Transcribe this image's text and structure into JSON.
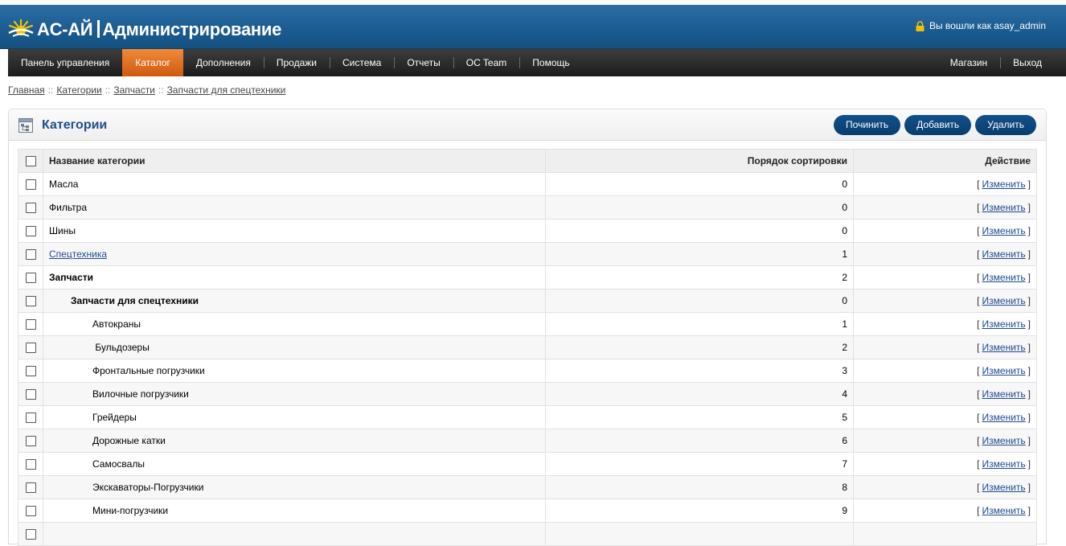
{
  "header": {
    "logo_text": "AC-AЙ",
    "logo_suffix": "Администрирование",
    "logged_in_text": "Вы вошли как asay_admin"
  },
  "menu": {
    "left": [
      "Панель управления",
      "Каталог",
      "Дополнения",
      "Продажи",
      "Система",
      "Отчеты",
      "OC Team",
      "Помощь"
    ],
    "right": [
      "Магазин",
      "Выход"
    ],
    "active": "Каталог"
  },
  "breadcrumb": [
    "Главная",
    "Категории",
    "Запчасти",
    "Запчасти для спецтехники"
  ],
  "box": {
    "title": "Категории",
    "buttons": [
      "Починить",
      "Добавить",
      "Удалить"
    ]
  },
  "table": {
    "headers": {
      "name": "Название категории",
      "sort": "Порядок сортировки",
      "action": "Действие"
    },
    "action_open": "[",
    "action_label": "Изменить",
    "action_close": "]",
    "rows": [
      {
        "name": "Масла",
        "sort": "0",
        "level": 0,
        "style": "normal"
      },
      {
        "name": "Фильтра",
        "sort": "0",
        "level": 0,
        "style": "normal"
      },
      {
        "name": "Шины",
        "sort": "0",
        "level": 0,
        "style": "normal"
      },
      {
        "name": "Спецтехника",
        "sort": "1",
        "level": 0,
        "style": "link"
      },
      {
        "name": "Запчасти",
        "sort": "2",
        "level": 0,
        "style": "bold"
      },
      {
        "name": "Запчасти для спецтехники",
        "sort": "0",
        "level": 1,
        "style": "bold"
      },
      {
        "name": "Автокраны",
        "sort": "1",
        "level": 2,
        "style": "normal"
      },
      {
        "name": " Бульдозеры",
        "sort": "2",
        "level": 2,
        "style": "normal"
      },
      {
        "name": "Фронтальные погрузчики",
        "sort": "3",
        "level": 2,
        "style": "normal"
      },
      {
        "name": "Вилочные погрузчики",
        "sort": "4",
        "level": 2,
        "style": "normal"
      },
      {
        "name": "Грейдеры",
        "sort": "5",
        "level": 2,
        "style": "normal"
      },
      {
        "name": "Дорожные катки",
        "sort": "6",
        "level": 2,
        "style": "normal"
      },
      {
        "name": "Самосвалы",
        "sort": "7",
        "level": 2,
        "style": "normal"
      },
      {
        "name": "Экскаваторы-Погрузчики",
        "sort": "8",
        "level": 2,
        "style": "normal"
      },
      {
        "name": "Мини-погрузчики",
        "sort": "9",
        "level": 2,
        "style": "normal"
      },
      {
        "name": "",
        "sort": "",
        "level": 0,
        "style": "normal"
      }
    ]
  },
  "colors": {
    "header": "#1e5f96",
    "menu": "#2a2a2a",
    "menu_active": "#e06d1f",
    "button": "#0e4a82",
    "title": "#1e4f8a"
  }
}
